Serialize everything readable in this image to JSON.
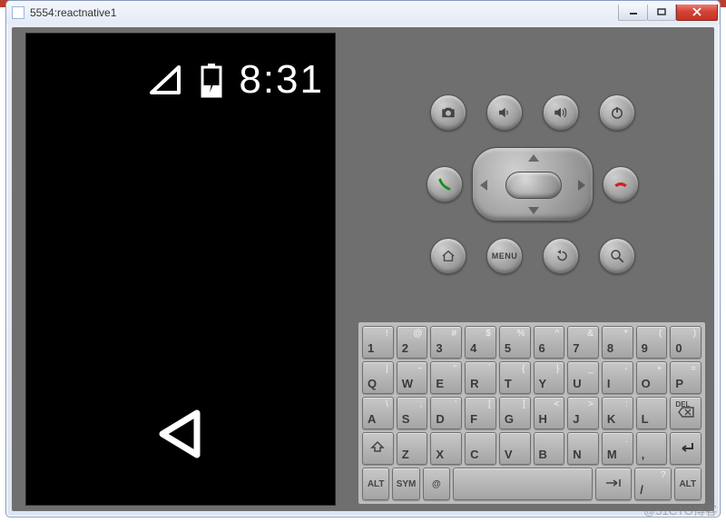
{
  "window": {
    "title": "5554:reactnative1",
    "buttons": {
      "min": "—",
      "max": "▭",
      "close": "x"
    }
  },
  "status": {
    "time": "8:31"
  },
  "controls": {
    "menu_label": "MENU"
  },
  "keyboard": {
    "row1": [
      {
        "m": "1",
        "s": "!"
      },
      {
        "m": "2",
        "s": "@"
      },
      {
        "m": "3",
        "s": "#"
      },
      {
        "m": "4",
        "s": "$"
      },
      {
        "m": "5",
        "s": "%"
      },
      {
        "m": "6",
        "s": "^"
      },
      {
        "m": "7",
        "s": "&"
      },
      {
        "m": "8",
        "s": "*"
      },
      {
        "m": "9",
        "s": "("
      },
      {
        "m": "0",
        "s": ")"
      }
    ],
    "row2": [
      {
        "m": "Q",
        "s": "|"
      },
      {
        "m": "W",
        "s": "~"
      },
      {
        "m": "E",
        "s": "\""
      },
      {
        "m": "R",
        "s": "`"
      },
      {
        "m": "T",
        "s": "{"
      },
      {
        "m": "Y",
        "s": "}"
      },
      {
        "m": "U",
        "s": "_"
      },
      {
        "m": "I",
        "s": "-"
      },
      {
        "m": "O",
        "s": "+"
      },
      {
        "m": "P",
        "s": "="
      }
    ],
    "row3": [
      {
        "m": "A",
        "s": "\\"
      },
      {
        "m": "S",
        "s": ";"
      },
      {
        "m": "D",
        "s": "'"
      },
      {
        "m": "F",
        "s": "["
      },
      {
        "m": "G",
        "s": "]"
      },
      {
        "m": "H",
        "s": "<"
      },
      {
        "m": "J",
        "s": ">"
      },
      {
        "m": "K",
        "s": ":"
      },
      {
        "m": "L",
        "s": ""
      }
    ],
    "row4": [
      {
        "m": "Z",
        "s": ""
      },
      {
        "m": "X",
        "s": ""
      },
      {
        "m": "C",
        "s": ""
      },
      {
        "m": "V",
        "s": ""
      },
      {
        "m": "B",
        "s": ""
      },
      {
        "m": "N",
        "s": ""
      },
      {
        "m": "M",
        "s": "."
      }
    ],
    "row5": {
      "alt": "ALT",
      "sym": "SYM",
      "at": "@",
      "slash": "/",
      "comma": ",",
      "quest": "?",
      "del": "DEL"
    }
  },
  "watermark": "@51CTO博客"
}
